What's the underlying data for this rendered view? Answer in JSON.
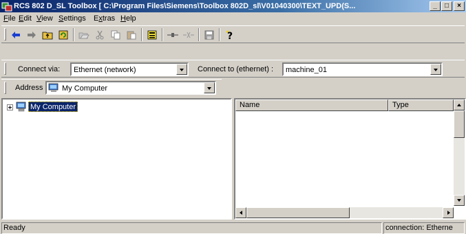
{
  "window": {
    "title": "RCS 802  D_SL  Toolbox [ C:\\Program Files\\Siemens\\Toolbox 802D_sl\\V01040300\\TEXT_UPD(S...",
    "controls": {
      "minimize": "_",
      "maximize": "□",
      "close": "×"
    }
  },
  "menu": [
    {
      "accel": "F",
      "rest": "ile"
    },
    {
      "accel": "E",
      "rest": "dit"
    },
    {
      "accel": "V",
      "rest": "iew"
    },
    {
      "accel": "S",
      "rest": "ettings"
    },
    {
      "pre": "E",
      "accel": "x",
      "rest": "tras"
    },
    {
      "accel": "H",
      "rest": "elp"
    }
  ],
  "toolbar": {
    "icons": [
      "back-icon",
      "forward-icon",
      "up-folder-icon",
      "refresh-icon",
      "open-icon",
      "cut-icon",
      "copy-icon",
      "paste-icon",
      "properties-icon",
      "connect-icon",
      "disconnect-icon",
      "save-icon",
      "help-icon"
    ]
  },
  "connection": {
    "label_via": "Connect via:",
    "via_value": "Ethernet (network)",
    "label_to": "Connect to (ethernet) :",
    "to_value": "machine_01"
  },
  "address": {
    "label": "Address",
    "value": "My Computer"
  },
  "tree": {
    "items": [
      {
        "label": "My Computer",
        "selected": true,
        "expanded": false
      }
    ]
  },
  "list": {
    "columns": [
      "Name",
      "Type"
    ]
  },
  "status": {
    "text": "Ready",
    "connection": "connection: Etherne"
  },
  "colors": {
    "title_start": "#0a246a",
    "title_end": "#a6caf0",
    "face": "#d4d0c8",
    "selection": "#0a246a"
  }
}
